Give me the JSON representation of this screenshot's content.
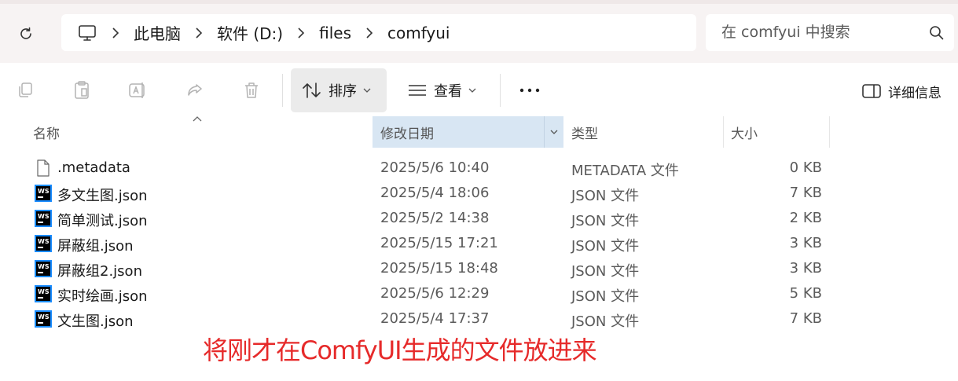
{
  "window": {
    "accent_color": "#005fb8"
  },
  "address_bar": {
    "breadcrumbs": [
      "此电脑",
      "软件 (D:)",
      "files",
      "comfyui"
    ]
  },
  "search": {
    "placeholder": "在 comfyui 中搜索",
    "value": ""
  },
  "toolbar": {
    "sort_label": "排序",
    "view_label": "查看",
    "details_label": "详细信息",
    "icons": [
      "copy-icon",
      "paste-icon",
      "rename-icon",
      "share-icon",
      "delete-icon",
      "sort-icon",
      "view-icon",
      "more-icon",
      "details-pane-icon"
    ]
  },
  "columns": {
    "name": "名称",
    "date": "修改日期",
    "type": "类型",
    "size": "大小"
  },
  "files": [
    {
      "name": ".metadata",
      "date": "2025/5/6 10:40",
      "type": "METADATA 文件",
      "size": "0 KB",
      "icon": "generic-file-icon"
    },
    {
      "name": "多文生图.json",
      "date": "2025/5/4 18:06",
      "type": "JSON 文件",
      "size": "7 KB",
      "icon": "webstorm-file-icon"
    },
    {
      "name": "简单测试.json",
      "date": "2025/5/2 14:38",
      "type": "JSON 文件",
      "size": "2 KB",
      "icon": "webstorm-file-icon"
    },
    {
      "name": "屏蔽组.json",
      "date": "2025/5/15 17:21",
      "type": "JSON 文件",
      "size": "3 KB",
      "icon": "webstorm-file-icon"
    },
    {
      "name": "屏蔽组2.json",
      "date": "2025/5/15 18:48",
      "type": "JSON 文件",
      "size": "3 KB",
      "icon": "webstorm-file-icon"
    },
    {
      "name": "实时绘画.json",
      "date": "2025/5/6 12:29",
      "type": "JSON 文件",
      "size": "5 KB",
      "icon": "webstorm-file-icon"
    },
    {
      "name": "文生图.json",
      "date": "2025/5/4 17:37",
      "type": "JSON 文件",
      "size": "7 KB",
      "icon": "webstorm-file-icon"
    }
  ],
  "annotation": {
    "text": "将刚才在ComfyUI生成的文件放进来",
    "color": "#e62a2a"
  }
}
